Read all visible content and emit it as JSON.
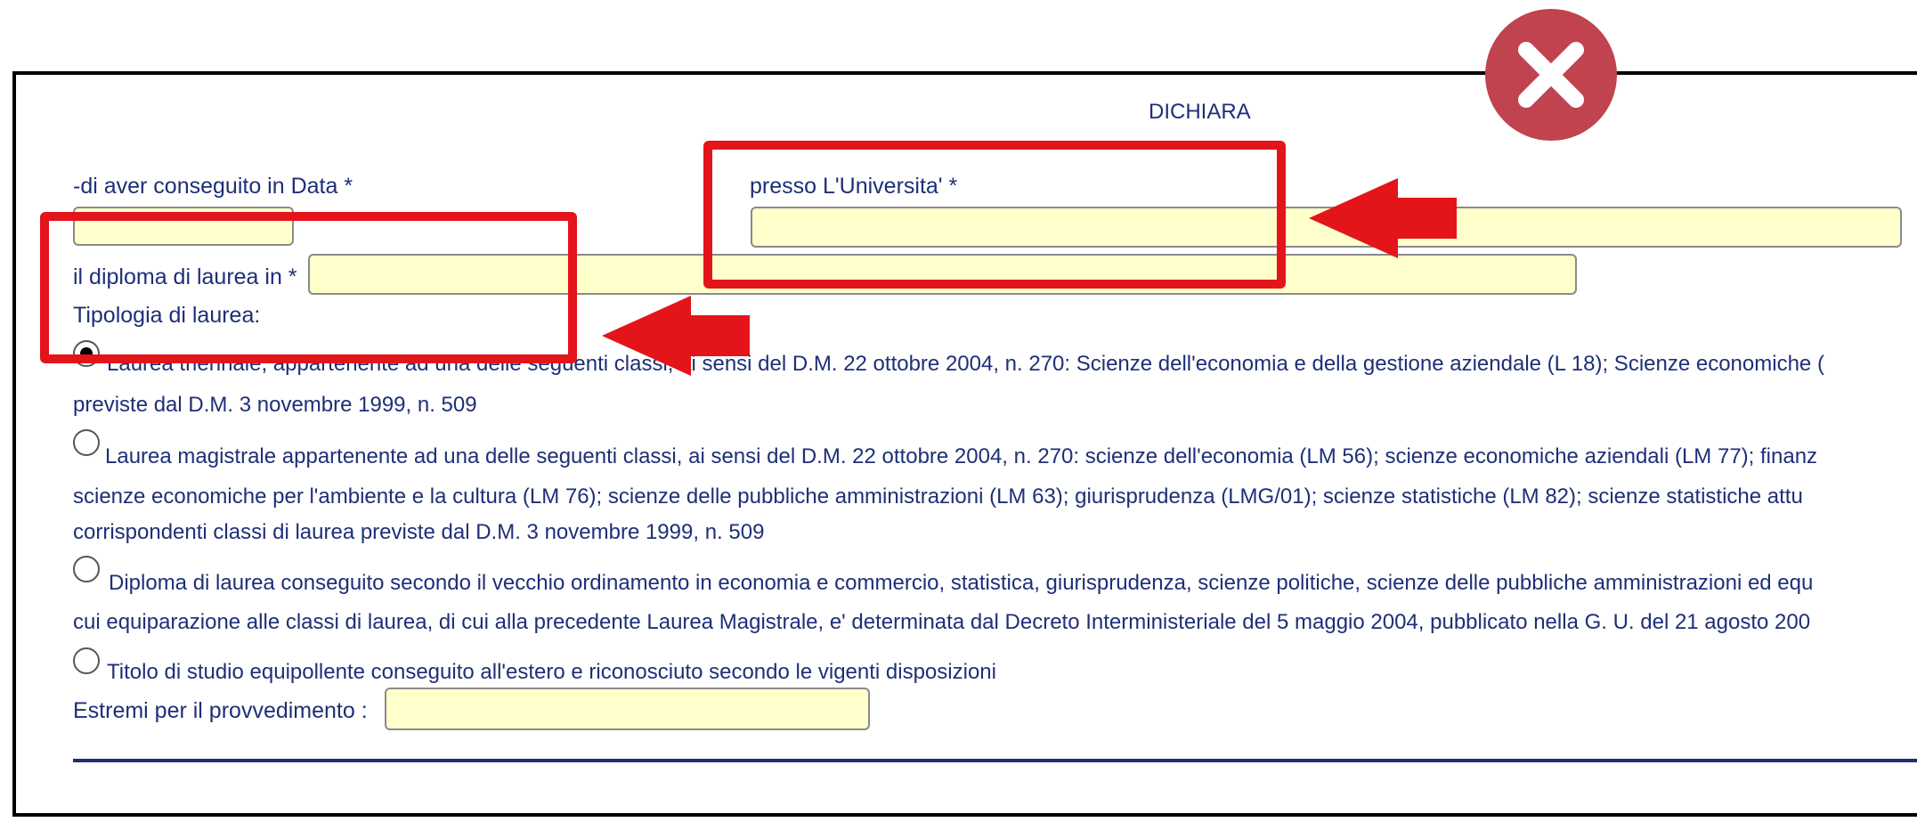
{
  "heading": "DICHIARA",
  "fields": {
    "date_label": "-di aver conseguito in Data *",
    "university_label": "presso L'Universita' *",
    "diploma_label": "il diploma di laurea in *",
    "typology_label": "Tipologia di laurea:",
    "provvedimento_label": "Estremi per il provvedimento :"
  },
  "options": [
    {
      "line1": "Laurea triennale, appartenente ad una delle seguenti classi, ai sensi del D.M. 22 ottobre 2004, n. 270: Scienze dell'economia e della gestione aziendale (L 18); Scienze economiche (",
      "line2": "previste dal D.M. 3 novembre 1999, n. 509"
    },
    {
      "line1": "Laurea magistrale appartenente ad una delle seguenti classi, ai sensi del D.M. 22 ottobre 2004, n. 270: scienze dell'economia (LM 56); scienze economiche aziendali (LM 77); finanz",
      "line2": "scienze economiche per l'ambiente e la cultura (LM 76); scienze delle pubbliche amministrazioni (LM 63); giurisprudenza (LMG/01); scienze statistiche (LM 82); scienze statistiche attu",
      "line3": "corrispondenti classi di laurea previste dal D.M. 3 novembre 1999, n. 509"
    },
    {
      "line1": "Diploma di laurea conseguito secondo il vecchio ordinamento in economia e commercio, statistica, giurisprudenza, scienze politiche, scienze delle pubbliche amministrazioni ed equ",
      "line2": "cui equiparazione alle classi di laurea, di cui alla precedente Laurea Magistrale, e' determinata dal Decreto Interministeriale del 5 maggio 2004, pubblicato nella G. U. del 21 agosto 200"
    },
    {
      "line1": "Titolo di studio equipollente conseguito all'estero e riconosciuto secondo le vigenti disposizioni"
    }
  ],
  "selected_option": 0,
  "annotation": {
    "box_color": "#e3151a",
    "close_icon": "close-x-icon",
    "close_color": "#c0434f"
  }
}
